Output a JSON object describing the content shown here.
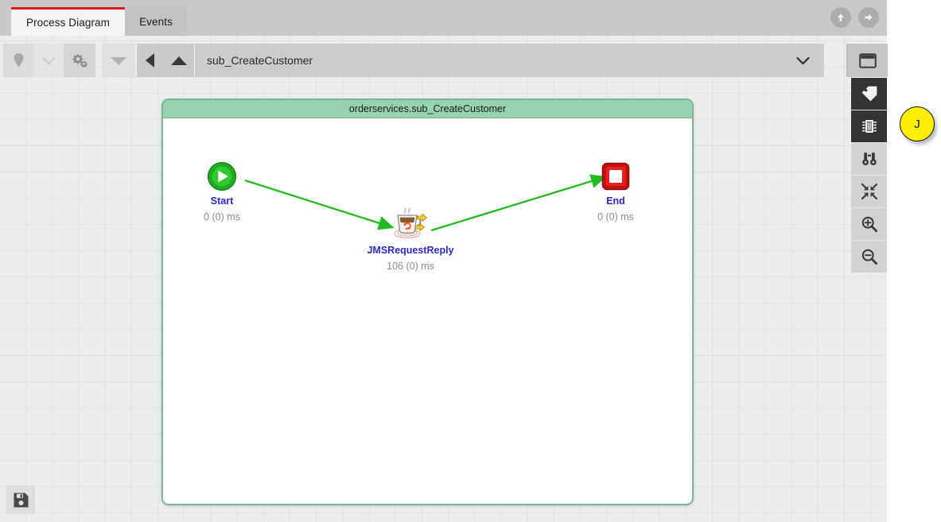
{
  "tabs": [
    {
      "label": "Process Diagram",
      "active": true,
      "name": "tab-process-diagram"
    },
    {
      "label": "Events",
      "active": false,
      "name": "tab-events"
    }
  ],
  "top_actions": [
    {
      "name": "upload-icon",
      "icon": "arrow-up-circle"
    },
    {
      "name": "forward-icon",
      "icon": "arrow-right-circle"
    }
  ],
  "toolbar": {
    "pin_icon": "location-pin-icon",
    "chevron_icon": "chevron-down-icon",
    "gear_icon": "gears-icon",
    "triangle_icon": "triangle-down-icon",
    "prev_icon": "triangle-left-icon",
    "up_icon": "triangle-up-icon",
    "selected_process": "sub_CreateCustomer",
    "dropdown_placeholder": "sub_CreateCustomer",
    "caret_icon": "chevron-down-icon",
    "window_icon": "window-panel-icon"
  },
  "rail": [
    {
      "name": "tag-icon",
      "label": "Tags",
      "active": true
    },
    {
      "name": "chip-icon",
      "label": "Components",
      "active": true
    },
    {
      "name": "binoculars-icon",
      "label": "Search",
      "active": false
    },
    {
      "name": "collapse-icon",
      "label": "Fit to view",
      "active": false
    },
    {
      "name": "zoom-in-icon",
      "label": "Zoom in",
      "active": false
    },
    {
      "name": "zoom-out-icon",
      "label": "Zoom out",
      "active": false
    }
  ],
  "avatar": {
    "initial": "J",
    "color": "#ffee00"
  },
  "save": {
    "icon": "save-floppy-icon",
    "label": "Save"
  },
  "diagram": {
    "group_title": "orderservices.sub_CreateCustomer",
    "nodes": [
      {
        "id": "start",
        "label": "Start",
        "time": "0 (0) ms",
        "icon": "start-play-icon"
      },
      {
        "id": "jms",
        "label": "JMSRequestReply",
        "time": "106 (0) ms",
        "icon": "jms-request-reply-icon"
      },
      {
        "id": "end",
        "label": "End",
        "time": "0 (0) ms",
        "icon": "end-stop-icon"
      }
    ],
    "edges": [
      {
        "from": "start",
        "to": "jms"
      },
      {
        "from": "jms",
        "to": "end"
      }
    ],
    "edge_color": "#22bb22",
    "label_color": "#2a2ad0",
    "time_color": "#8c8c8c",
    "group_header_color": "#96d2b0"
  }
}
